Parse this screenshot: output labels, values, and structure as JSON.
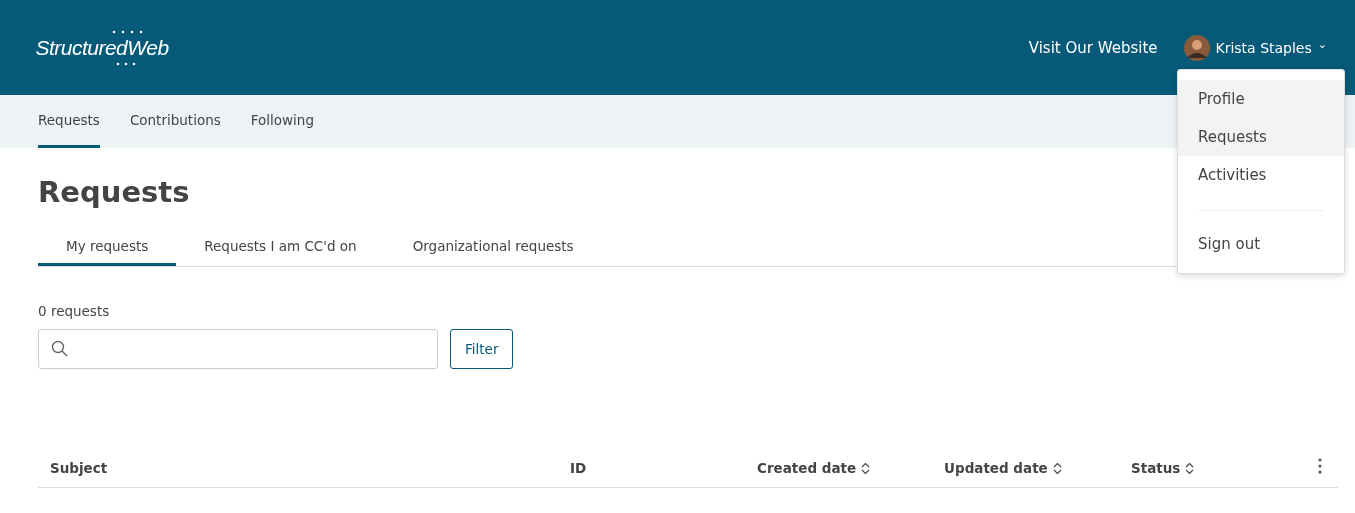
{
  "header": {
    "logo": "StructuredWeb",
    "link": "Visit Our Website",
    "user": {
      "name": "Krista Staples",
      "caret": "⌄"
    }
  },
  "user_menu": {
    "items": [
      {
        "label": "Profile",
        "highlighted": true,
        "kind": "item"
      },
      {
        "label": "Requests",
        "highlighted": true,
        "kind": "item"
      },
      {
        "label": "Activities",
        "highlighted": false,
        "kind": "item"
      },
      {
        "kind": "divider"
      },
      {
        "label": "Sign out",
        "highlighted": false,
        "kind": "item"
      }
    ]
  },
  "nav": [
    {
      "label": "Requests",
      "selected": true
    },
    {
      "label": "Contributions",
      "selected": false
    },
    {
      "label": "Following",
      "selected": false
    }
  ],
  "title": "Requests",
  "tabs": [
    {
      "label": "My requests",
      "selected": true
    },
    {
      "label": "Requests I am CC'd on",
      "selected": false
    },
    {
      "label": "Organizational requests",
      "selected": false
    }
  ],
  "count": "0 requests",
  "filter_button": "Filter",
  "table": {
    "columns": [
      {
        "label": "Subject",
        "sortable": false
      },
      {
        "label": "ID",
        "sortable": false
      },
      {
        "label": "Created date",
        "sortable": true
      },
      {
        "label": "Updated date",
        "sortable": true
      },
      {
        "label": "Status",
        "sortable": true
      }
    ]
  }
}
